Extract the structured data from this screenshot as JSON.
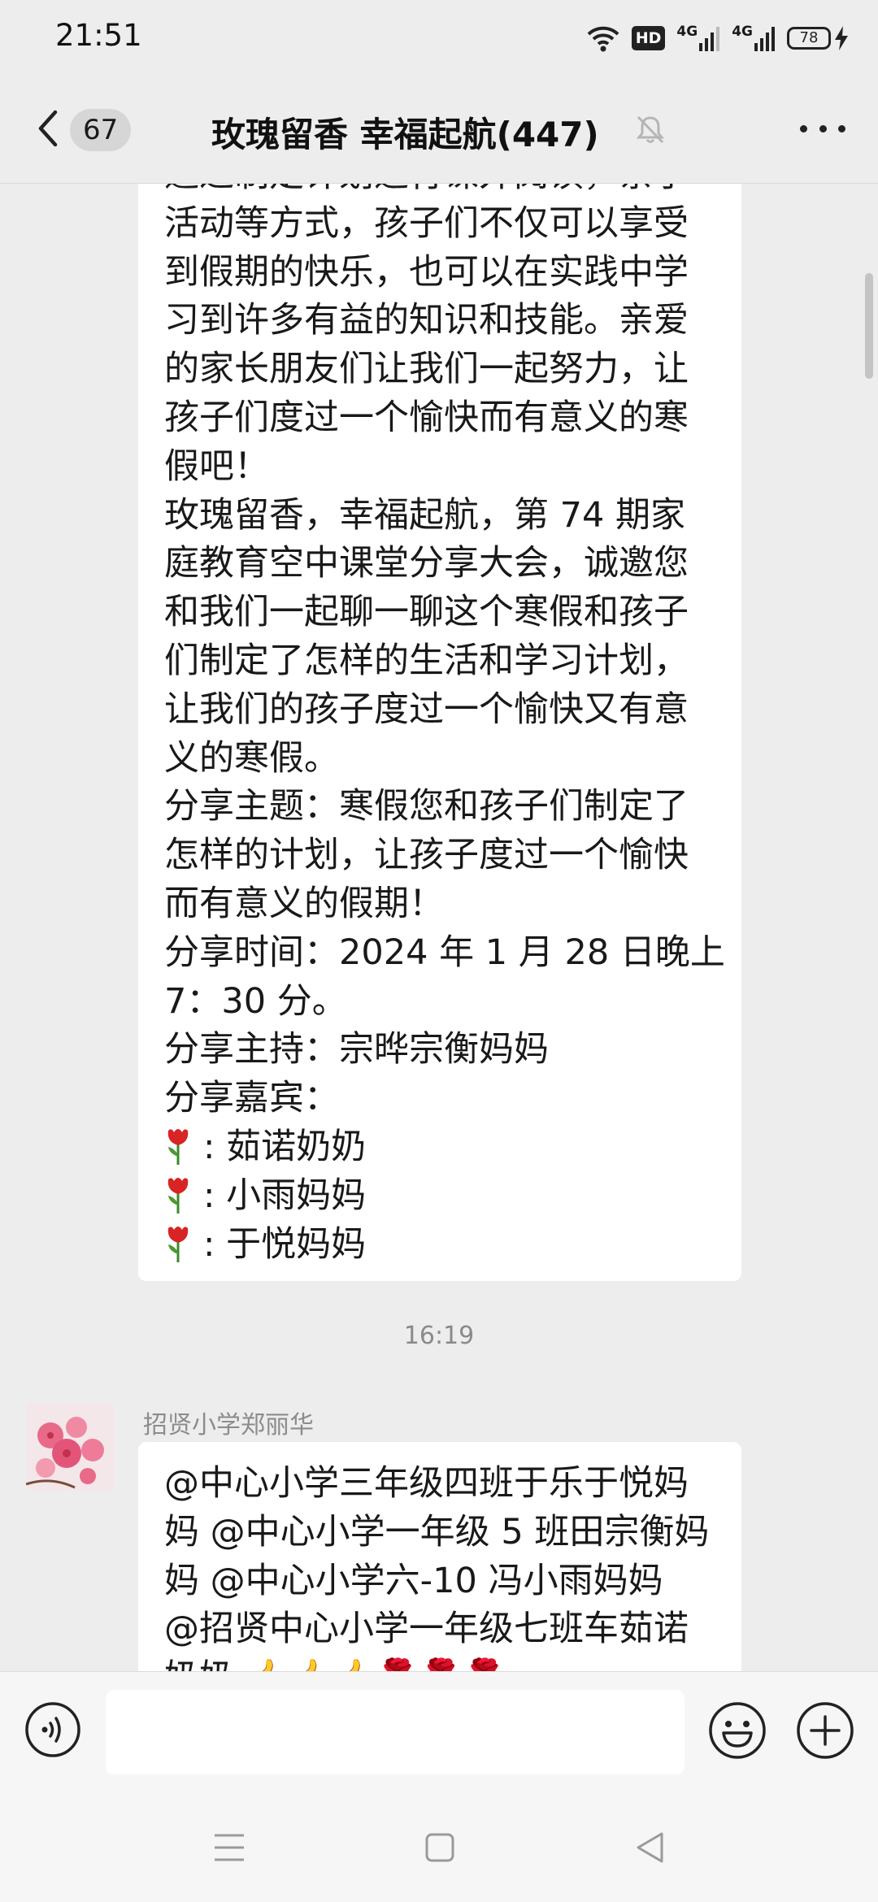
{
  "status": {
    "time": "21:51",
    "network_1": "4G",
    "network_2": "4G",
    "hd_label": "HD",
    "battery": "78"
  },
  "nav": {
    "unread_count": "67",
    "title": "玫瑰留香  幸福起航(447)",
    "back_icon": "chevron-left-icon",
    "mute_icon": "bell-muted-icon",
    "more_icon": "more-dots-icon"
  },
  "messages": [
    {
      "lines": [
        "通过制定计划进行课外阅读，亲子",
        "活动等方式，孩子们不仅可以享受",
        "到假期的快乐，也可以在实践中学",
        "习到许多有益的知识和技能。亲爱",
        "的家长朋友们让我们一起努力，让",
        "孩子们度过一个愉快而有意义的寒",
        "假吧！",
        "玫瑰留香，幸福起航，第 74 期家",
        "庭教育空中课堂分享大会，诚邀您",
        "和我们一起聊一聊这个寒假和孩子",
        "们制定了怎样的生活和学习计划，",
        "让我们的孩子度过一个愉快又有意",
        "义的寒假。",
        "分享主题：寒假您和孩子们制定了",
        "怎样的计划，让孩子度过一个愉快",
        "而有意义的假期！",
        "分享时间：2024 年 1 月 28 日晚上",
        "7：30 分。",
        "分享主持：宗晔宗衡妈妈",
        "分享嘉宾："
      ],
      "guests": [
        ":  茹诺奶奶",
        ":  小雨妈妈",
        ":  于悦妈妈"
      ]
    },
    {
      "timestamp": "16:19",
      "sender": "招贤小学郑丽华",
      "lines": [
        "@中心小学三年级四班于乐于悦妈",
        "妈 @中心小学一年级 5 班田宗衡妈",
        "妈  @中心小学六-10 冯小雨妈妈",
        "@招贤中心小学一年级七班车茹诺",
        "奶奶 👍👍👍🌹🌹🌹"
      ]
    }
  ],
  "input": {
    "value": "",
    "placeholder": "",
    "voice_icon": "voice-icon",
    "emoji_icon": "emoji-icon",
    "plus_icon": "plus-icon"
  },
  "colors": {
    "background": "#ededed",
    "bubble": "#ffffff",
    "timestamp": "#8a8a8a"
  }
}
